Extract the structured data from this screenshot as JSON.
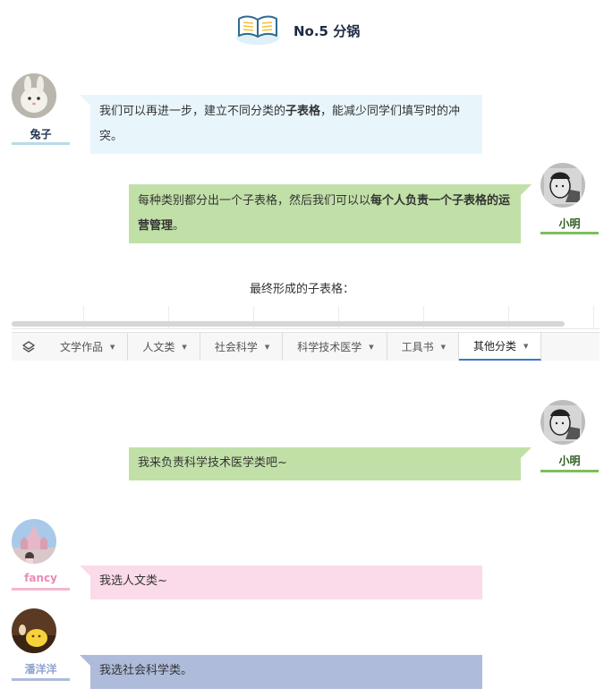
{
  "header": {
    "title": "No.5 分锅"
  },
  "messages": {
    "m1": {
      "name": "兔子",
      "seg1": "我们可以再进一步，建立不同分类的",
      "bold": "子表格",
      "seg2": "，能减少同学们填写时的冲突。"
    },
    "m2": {
      "name": "小明",
      "seg1": "每种类别都分出一个子表格，然后我们可以以",
      "bold": "每个人负责一个子表格的运营管理",
      "seg2": "。"
    },
    "m3": {
      "name": "小明",
      "text": "我来负责科学技术医学类吧~"
    },
    "m4": {
      "name": "fancy",
      "text": "我选人文类~"
    },
    "m5": {
      "name": "潘洋洋",
      "text": "我选社会科学类。"
    }
  },
  "caption": "最终形成的子表格：",
  "tabs": [
    "文学作品",
    "人文类",
    "社会科学",
    "科学技术医学",
    "工具书",
    "其他分类"
  ],
  "active_tab": "其他分类",
  "colors": {
    "rabbit_bubble": "#e8f6fc",
    "ming_bubble": "#c1e0a8",
    "fancy_bubble": "#fbdbe9",
    "pan_bubble": "#aebbda",
    "ming_name": "#2f5f1f",
    "fancy_name": "#e98bb4",
    "pan_name": "#8fa3cf",
    "tab_active_border": "#3a78c9"
  },
  "icons": [
    "book-icon",
    "layers-icon",
    "dropdown-caret-icon"
  ]
}
